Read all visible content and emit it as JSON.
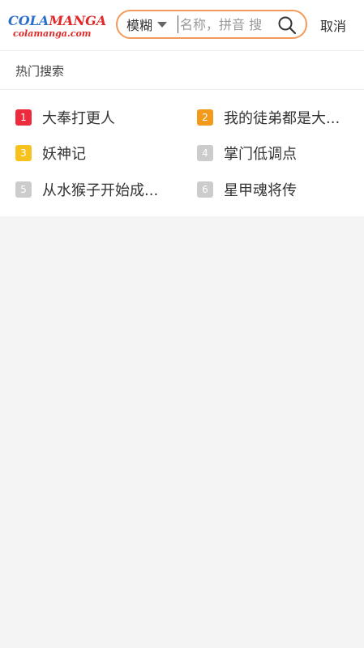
{
  "header": {
    "logo": {
      "line1_cola": "COLA",
      "line1_manga": "MANGA",
      "line2": "colamanga.com"
    },
    "search": {
      "mode": "模糊",
      "placeholder": "名称，拼音 搜",
      "value": ""
    },
    "cancel_label": "取消"
  },
  "hot_search": {
    "title": "热门搜索",
    "items": [
      {
        "rank": "1",
        "title": "大奉打更人",
        "color": "#ec2b3c"
      },
      {
        "rank": "2",
        "title": "我的徒弟都是大...",
        "color": "#f39a1d"
      },
      {
        "rank": "3",
        "title": "妖神记",
        "color": "#f7c21e"
      },
      {
        "rank": "4",
        "title": "掌门低调点",
        "color": "#cccccc"
      },
      {
        "rank": "5",
        "title": "从水猴子开始成...",
        "color": "#cccccc"
      },
      {
        "rank": "6",
        "title": "星甲魂将传",
        "color": "#cccccc"
      }
    ]
  },
  "colors": {
    "search_border": "#f39a5b",
    "background": "#f4f4f4"
  }
}
